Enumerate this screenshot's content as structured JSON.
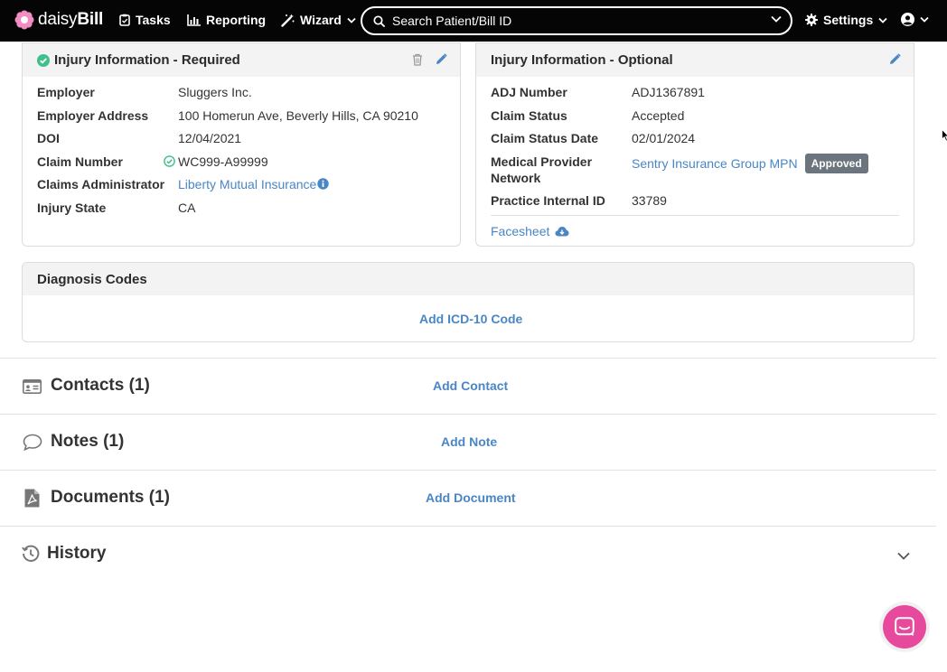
{
  "nav": {
    "logo_prefix": "daisy",
    "logo_suffix": "Bill",
    "tasks": "Tasks",
    "reporting": "Reporting",
    "wizard": "Wizard",
    "search_placeholder": "Search Patient/Bill ID",
    "settings": "Settings"
  },
  "injury_required": {
    "title": "Injury Information - Required",
    "rows": [
      {
        "label": "Employer",
        "value": "Sluggers Inc."
      },
      {
        "label": "Employer Address",
        "value": "100 Homerun Ave, Beverly Hills, CA 90210"
      },
      {
        "label": "DOI",
        "value": "12/04/2021"
      },
      {
        "label": "Claim Number",
        "value": "WC999-A99999"
      },
      {
        "label": "Claims Administrator",
        "value": "Liberty Mutual Insurance"
      },
      {
        "label": "Injury State",
        "value": "CA"
      }
    ]
  },
  "injury_optional": {
    "title": "Injury Information - Optional",
    "rows": [
      {
        "label": "ADJ Number",
        "value": "ADJ1367891"
      },
      {
        "label": "Claim Status",
        "value": "Accepted"
      },
      {
        "label": "Claim Status Date",
        "value": "02/01/2024"
      },
      {
        "label": "Medical Provider Network",
        "value": "Sentry Insurance Group MPN",
        "badge": "Approved"
      },
      {
        "label": "Practice Internal ID",
        "value": "33789"
      }
    ],
    "facesheet": "Facesheet"
  },
  "diagnosis": {
    "title": "Diagnosis Codes",
    "add": "Add ICD-10 Code"
  },
  "sections": {
    "contacts": {
      "title": "Contacts (1)",
      "add": "Add Contact"
    },
    "notes": {
      "title": "Notes (1)",
      "add": "Add Note"
    },
    "documents": {
      "title": "Documents (1)",
      "add": "Add Document"
    },
    "history": {
      "title": "History"
    }
  },
  "colors": {
    "nav_bg": "#050505",
    "link": "#4a86c5",
    "success": "#3fbf8a",
    "badge": "#6c757d",
    "chat": "#e7499c",
    "logo_pink": "#e7499c"
  }
}
